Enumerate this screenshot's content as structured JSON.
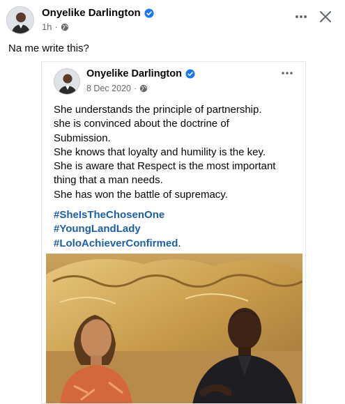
{
  "post": {
    "author": "Onyelike Darlington",
    "time": "1h",
    "text": "Na me write this?",
    "more_icon": "more-dots-icon",
    "close_icon": "close-x-icon"
  },
  "shared_post": {
    "author": "Onyelike Darlington",
    "date": "8 Dec 2020",
    "more_icon": "more-dots-icon",
    "lines": [
      "She understands the principle of partnership.",
      "she is convinced about the doctrine of",
      "Submission.",
      "She knows that loyalty and humility is the key.",
      "She is aware that Respect is the most important",
      "thing that a man needs.",
      "She has won the battle of supremacy."
    ],
    "hashtags": [
      "#SheIsTheChosenOne",
      "#YoungLandLady",
      "#LoloAchieverConfirmed"
    ],
    "hashtag_suffix": "."
  },
  "colors": {
    "verified_blue": "#1877f2",
    "hashtag_blue": "#1b5fa8",
    "meta_gray": "#65676b"
  }
}
